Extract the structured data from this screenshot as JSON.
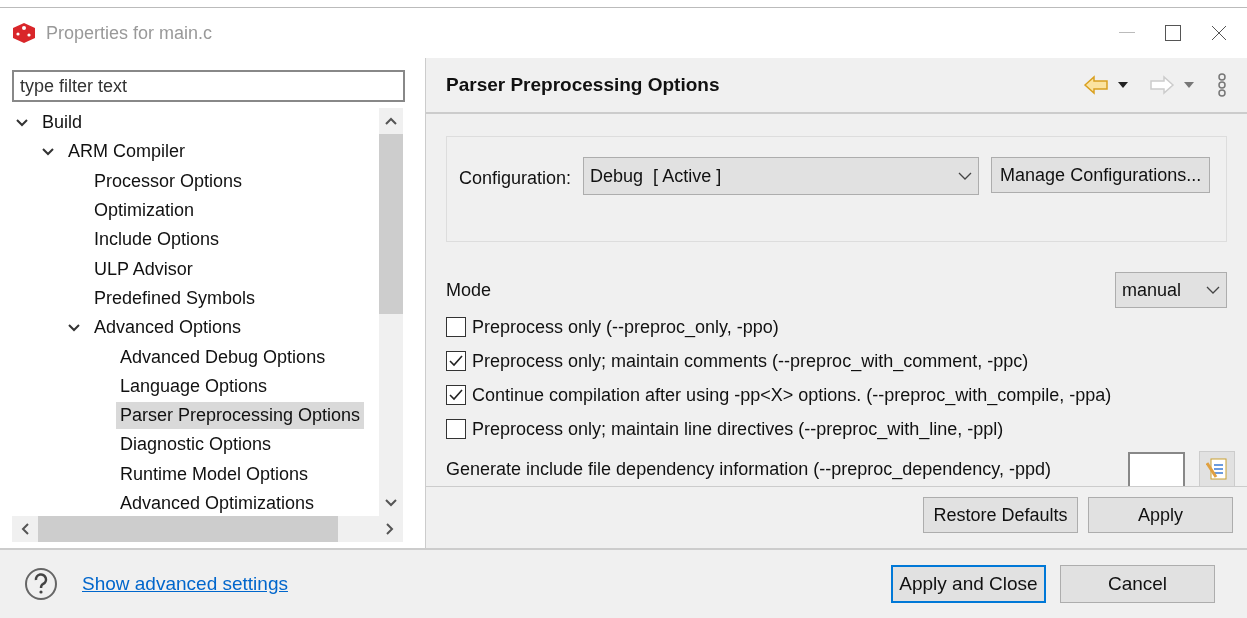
{
  "window": {
    "title": "Properties for main.c"
  },
  "filter": {
    "placeholder": "type filter text"
  },
  "tree": [
    {
      "label": "Build",
      "expanded": true,
      "selected": false,
      "children": [
        {
          "label": "ARM Compiler",
          "expanded": true,
          "selected": false,
          "children": [
            {
              "label": "Processor Options",
              "selected": false
            },
            {
              "label": "Optimization",
              "selected": false
            },
            {
              "label": "Include Options",
              "selected": false
            },
            {
              "label": "ULP Advisor",
              "selected": false
            },
            {
              "label": "Predefined Symbols",
              "selected": false
            },
            {
              "label": "Advanced Options",
              "expanded": true,
              "selected": false,
              "children": [
                {
                  "label": "Advanced Debug Options",
                  "selected": false
                },
                {
                  "label": "Language Options",
                  "selected": false
                },
                {
                  "label": "Parser Preprocessing Options",
                  "selected": true
                },
                {
                  "label": "Diagnostic Options",
                  "selected": false
                },
                {
                  "label": "Runtime Model Options",
                  "selected": false
                },
                {
                  "label": "Advanced Optimizations",
                  "selected": false
                }
              ]
            }
          ]
        }
      ]
    }
  ],
  "page": {
    "title": "Parser Preprocessing Options",
    "configuration": {
      "label": "Configuration:",
      "value": "Debug  [ Active ]",
      "button": "Manage Configurations..."
    },
    "mode": {
      "label": "Mode",
      "value": "manual"
    },
    "options": [
      {
        "label": "Preprocess only (--preproc_only, -ppo)",
        "checked": false
      },
      {
        "label": "Preprocess only; maintain comments (--preproc_with_comment, -ppc)",
        "checked": true
      },
      {
        "label": "Continue compilation after using -pp<X> options. (--preproc_with_compile, -ppa)",
        "checked": true
      },
      {
        "label": "Preprocess only; maintain line directives (--preproc_with_line, -ppl)",
        "checked": false
      }
    ],
    "dependency": {
      "label": "Generate include file dependency information (--preproc_dependency, -ppd)"
    },
    "buttons": [
      "Restore Defaults",
      "Apply"
    ]
  },
  "footer": {
    "link": "Show advanced settings",
    "buttons": [
      {
        "label": "Apply and Close",
        "focused": true
      },
      {
        "label": "Cancel",
        "focused": false
      }
    ]
  }
}
